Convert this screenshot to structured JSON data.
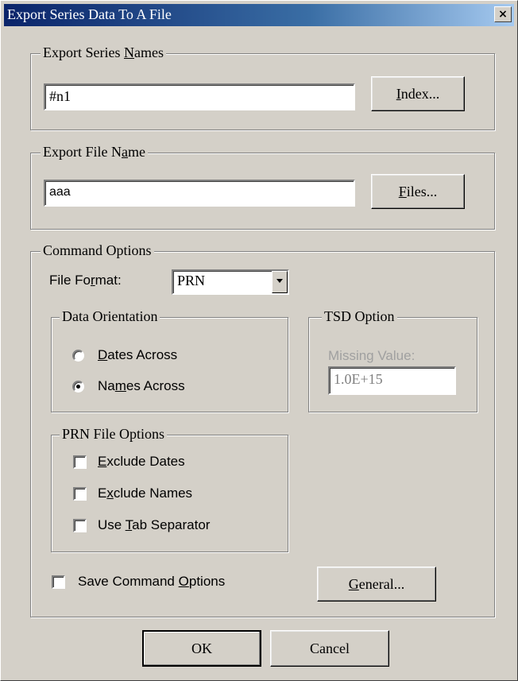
{
  "window": {
    "title": "Export Series Data To A File",
    "close_glyph": "×"
  },
  "export_series_names": {
    "legend_pre": "Export Series ",
    "legend_u": "N",
    "legend_post": "ames",
    "value": "#n1",
    "index_button": {
      "u": "I",
      "rest": "ndex..."
    }
  },
  "export_file_name": {
    "legend_pre": "Export File N",
    "legend_u": "a",
    "legend_post": "me",
    "value": "aaa",
    "files_button": {
      "u": "F",
      "rest": "iles..."
    }
  },
  "command_options": {
    "legend": "Command Options",
    "file_format": {
      "label_pre": "File Fo",
      "label_u": "r",
      "label_post": "mat:",
      "value": "PRN"
    },
    "data_orientation": {
      "legend": "Data Orientation",
      "dates_across": {
        "u": "D",
        "rest": "ates Across",
        "selected": false
      },
      "names_across": {
        "pre": "Na",
        "u": "m",
        "rest": "es Across",
        "selected": true
      }
    },
    "tsd_option": {
      "legend": "TSD Option",
      "missing_label": "Missing Value:",
      "missing_value": "1.0E+15"
    },
    "prn_file_options": {
      "legend": "PRN File Options",
      "exclude_dates": {
        "u": "E",
        "rest": "xclude Dates",
        "checked": false
      },
      "exclude_names": {
        "pre": "E",
        "u": "x",
        "rest": "clude Names",
        "checked": false
      },
      "use_tab": {
        "pre": "Use ",
        "u": "T",
        "rest": "ab Separator",
        "checked": false
      }
    },
    "save_command_options": {
      "pre": "Save Command ",
      "u": "O",
      "rest": "ptions",
      "checked": false
    },
    "general_button": {
      "u": "G",
      "rest": "eneral..."
    }
  },
  "buttons": {
    "ok": "OK",
    "cancel": "Cancel"
  }
}
